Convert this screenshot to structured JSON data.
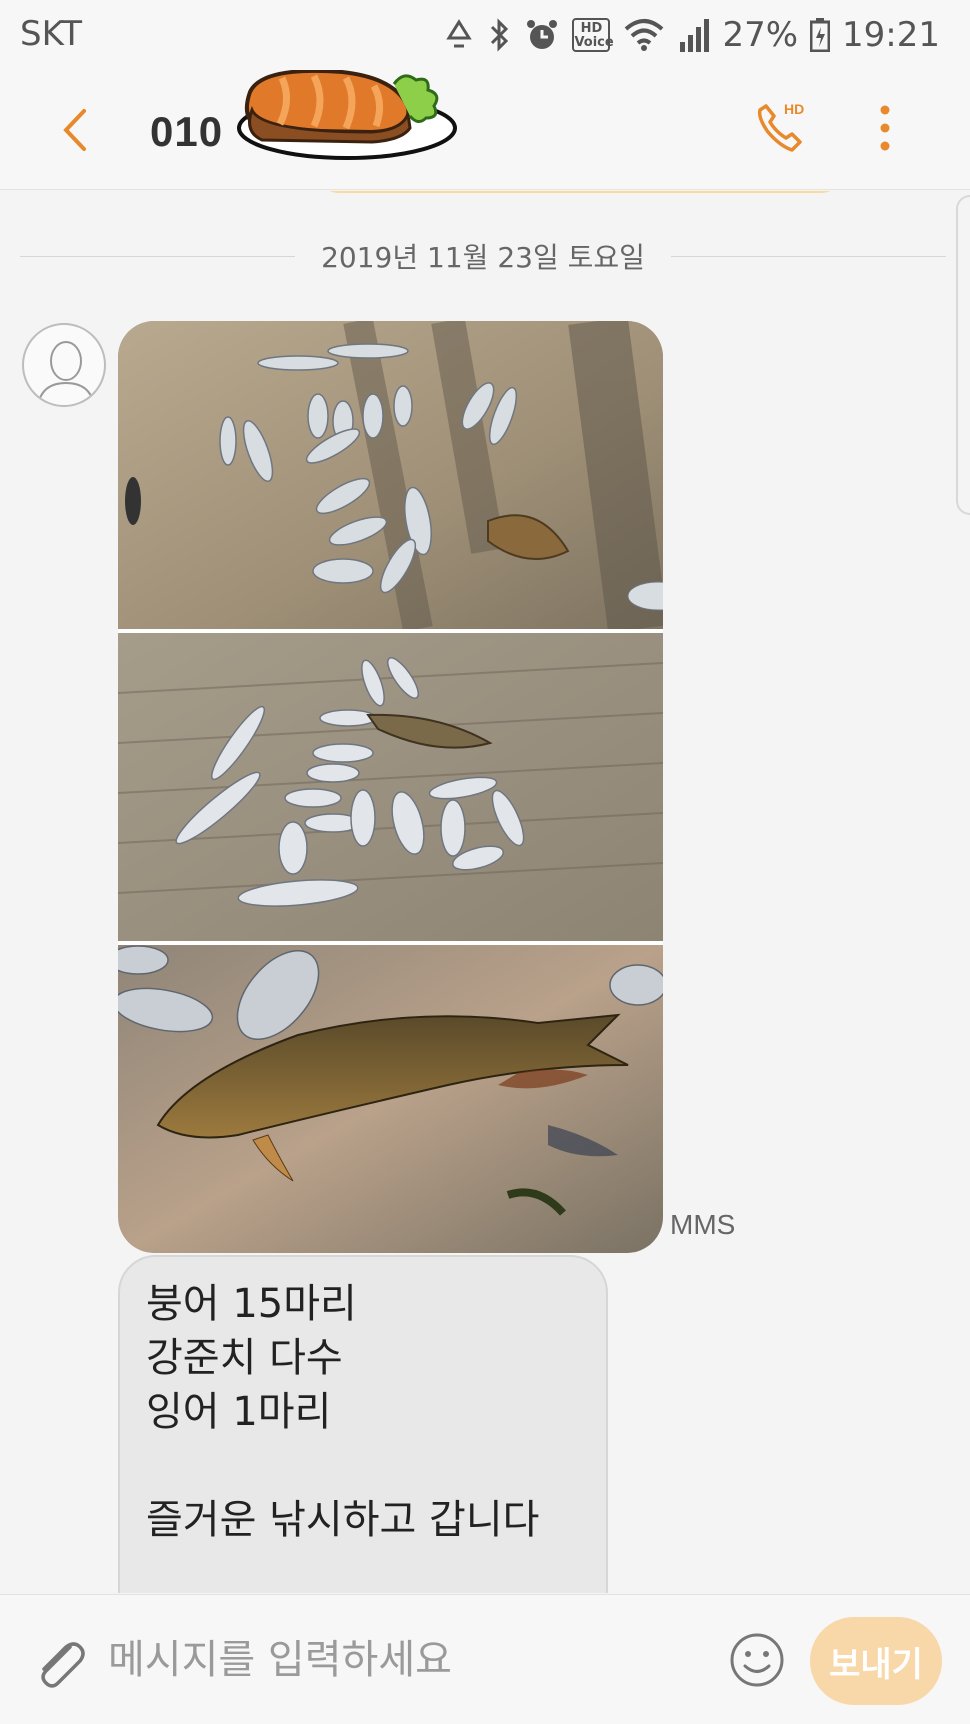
{
  "status_bar": {
    "carrier": "SKT",
    "hd_voice": "HD\nVoice",
    "battery_percent": "27%",
    "time": "19:21"
  },
  "app_bar": {
    "contact_name": "010",
    "call_badge": "HD",
    "accent_color": "#e8892b"
  },
  "conversation": {
    "date_divider": "2019년 11월 23일 토요일",
    "mms_label": "MMS",
    "message_text": "붕어 15마리\n강준치 다수\n잉어 1마리\n\n즐거운 낚시하고 갑니다"
  },
  "input_bar": {
    "placeholder": "메시지를 입력하세요",
    "send_label": "보내기",
    "send_color": "#f8d7a8"
  }
}
